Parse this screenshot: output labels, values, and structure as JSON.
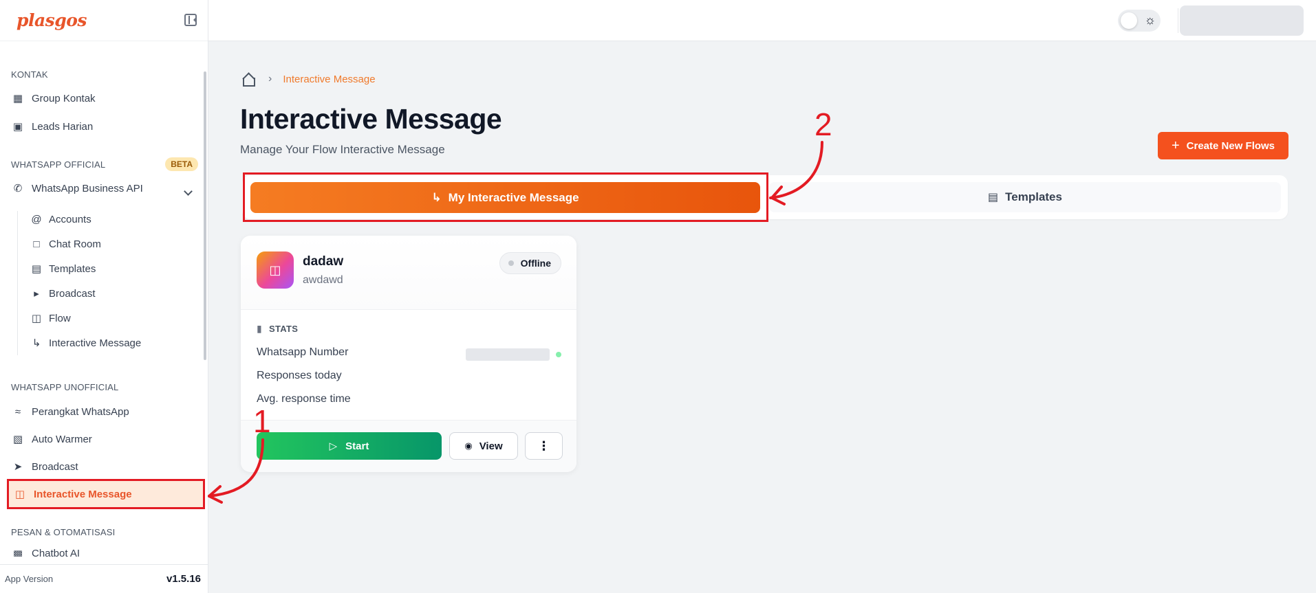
{
  "sidebar": {
    "logo": "plasgos",
    "sections": {
      "kontak": "KONTAK",
      "wa_official": "WHATSAPP OFFICIAL",
      "wa_unofficial": "WHATSAPP UNOFFICIAL",
      "pesan": "PESAN & OTOMATISASI"
    },
    "beta_badge": "BETA",
    "items": {
      "group_kontak": "Group Kontak",
      "leads_harian": "Leads Harian",
      "wa_business_api": "WhatsApp Business API",
      "accounts": "Accounts",
      "chat_room": "Chat Room",
      "templates": "Templates",
      "broadcast_sub": "Broadcast",
      "flow": "Flow",
      "interactive_sub": "Interactive Message",
      "perangkat": "Perangkat WhatsApp",
      "auto_warmer": "Auto Warmer",
      "broadcast": "Broadcast",
      "interactive_active": "Interactive Message",
      "chatbot": "Chatbot AI"
    },
    "footer": {
      "label": "App Version",
      "version": "v1.5.16"
    }
  },
  "breadcrumb": {
    "current": "Interactive Message"
  },
  "page": {
    "title": "Interactive Message",
    "subtitle": "Manage Your Flow Interactive Message",
    "create_button": "Create New Flows"
  },
  "tabs": {
    "active": "My Interactive Message",
    "other": "Templates"
  },
  "card": {
    "name": "dadaw",
    "description": "awdawd",
    "status": "Offline",
    "stats_title": "STATS",
    "rows": {
      "whatsapp_number": "Whatsapp Number",
      "responses_today": "Responses today",
      "avg_response": "Avg. response time"
    },
    "buttons": {
      "start": "Start",
      "view": "View",
      "more": "⋮"
    }
  },
  "annotations": {
    "one": "1",
    "two": "2"
  },
  "colors": {
    "accent": "#f4511e",
    "annotation_red": "#e31b23",
    "start_green": "#22c55e"
  }
}
